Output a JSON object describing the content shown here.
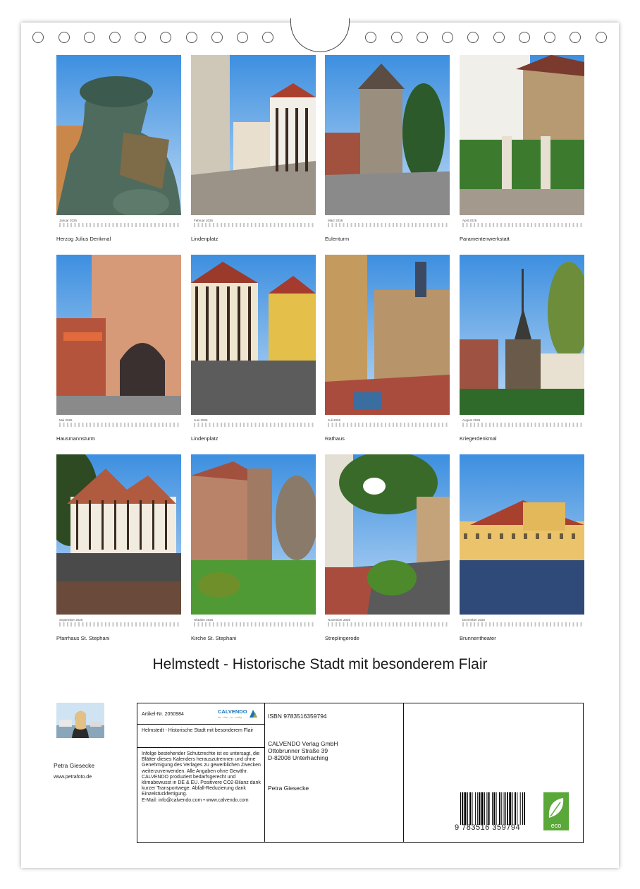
{
  "months": [
    {
      "month": "Januar 2026",
      "caption": "Herzog Julius Denkmal"
    },
    {
      "month": "Februar 2026",
      "caption": "Lindenplatz"
    },
    {
      "month": "März 2026",
      "caption": "Eulenturm"
    },
    {
      "month": "April 2026",
      "caption": "Paramentenwerkstatt"
    },
    {
      "month": "Mai 2026",
      "caption": "Hausmannsturm"
    },
    {
      "month": "Juni 2026",
      "caption": "Lindenplatz"
    },
    {
      "month": "Juli 2026",
      "caption": "Rathaus"
    },
    {
      "month": "August 2026",
      "caption": "Kriegerdenkmal"
    },
    {
      "month": "September 2026",
      "caption": "Pfarrhaus St. Stephani"
    },
    {
      "month": "Oktober 2026",
      "caption": "Kirche St. Stephani"
    },
    {
      "month": "November 2026",
      "caption": "Streplingerode"
    },
    {
      "month": "Dezember 2026",
      "caption": "Brunnentheater"
    }
  ],
  "title": "Helmstedt - Historische Stadt mit besonderem Flair",
  "author": {
    "name": "Petra Giesecke",
    "website": "www.petrafoto.de"
  },
  "info": {
    "article": "Artikel-Nr. 2050984",
    "logo": "CALVENDO",
    "logo_tagline": "for - like - to - entity",
    "short_title": "Helmstedt - Historische Stadt mit besonderem Flair",
    "legal": "Infolge bestehender Schutzrechte ist es untersagt, die Blätter dieses Kalenders herauszutrennen und ohne Genehmigung des Verlages zu gewerblichen Zwecken weiterzuverwenden. Alle Angaben ohne Gewähr.\nCALVENDO produziert bedarfsgerecht und klimabewusst in DE & EU. Positivere CO2-Bilanz dank kurzer Transportwege. Abfall-Reduzierung dank Einzelstückfertigung.\nE-Mail: info@calvendo.com • www.calvendo.com",
    "isbn": "ISBN 9783516359794",
    "publisher": "CALVENDO Verlag GmbH\nOttobrunner Straße 39\nD-82008 Unterhaching",
    "publisher_author": "Petra Giesecke",
    "barcode_number": "9 783516 359794",
    "eco_label": "eco"
  },
  "colors": {
    "sky": "#4a9ee8",
    "brick": "#b5533a",
    "timber": "#3a2a20",
    "grass": "#4f8f2f",
    "eco_green": "#5aa839"
  }
}
